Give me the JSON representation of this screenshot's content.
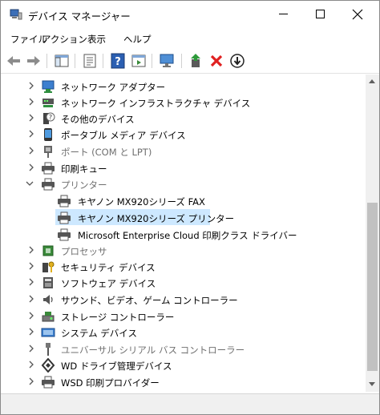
{
  "window": {
    "title": "デバイス マネージャー",
    "icon": "device-manager-icon"
  },
  "menu": [
    "ファイル",
    "アクション",
    "表示",
    "ヘルプ"
  ],
  "toolbar": {
    "buttons": [
      {
        "name": "back-button",
        "icon": "arrow-left-icon"
      },
      {
        "name": "forward-button",
        "icon": "arrow-right-icon"
      },
      {
        "name": "show-hide-console-tree-button",
        "icon": "console-tree-icon"
      },
      {
        "name": "properties-button",
        "icon": "properties-icon"
      },
      {
        "name": "help-button",
        "icon": "help-icon"
      },
      {
        "name": "update-driver-button",
        "icon": "update-driver-icon"
      },
      {
        "name": "scan-hardware-button",
        "icon": "scan-monitor-icon"
      },
      {
        "name": "enable-device-button",
        "icon": "enable-device-icon"
      },
      {
        "name": "uninstall-device-button",
        "icon": "red-x-icon"
      },
      {
        "name": "disable-device-button",
        "icon": "down-arrow-circle-icon"
      }
    ]
  },
  "tree": [
    {
      "label": "ネットワーク アダプター",
      "state": "collapsed",
      "icon": "network-adapter-icon"
    },
    {
      "label": "ネットワーク インフラストラクチャ デバイス",
      "state": "collapsed",
      "icon": "network-infrastructure-icon"
    },
    {
      "label": "その他のデバイス",
      "state": "collapsed",
      "icon": "unknown-device-icon"
    },
    {
      "label": "ポータブル メディア デバイス",
      "state": "collapsed",
      "icon": "portable-device-icon"
    },
    {
      "label": "ポート (COM と LPT)",
      "state": "collapsed",
      "icon": "port-icon",
      "disabled": true
    },
    {
      "label": "印刷キュー",
      "state": "collapsed",
      "icon": "printer-icon"
    },
    {
      "label": "プリンター",
      "state": "expanded",
      "icon": "printer-icon",
      "disabled": true
    },
    {
      "label": "キヤノン MX920シリーズ FAX",
      "state": "child",
      "icon": "printer-icon"
    },
    {
      "label": "キヤノン MX920シリーズ プリンター",
      "state": "child",
      "icon": "printer-icon",
      "selected": true
    },
    {
      "label": "Microsoft Enterprise Cloud 印刷クラス ドライバー",
      "state": "child",
      "icon": "printer-icon"
    },
    {
      "label": "プロセッサ",
      "state": "collapsed",
      "icon": "processor-icon",
      "disabled": true
    },
    {
      "label": "セキュリティ デバイス",
      "state": "collapsed",
      "icon": "security-key-icon"
    },
    {
      "label": "ソフトウェア デバイス",
      "state": "collapsed",
      "icon": "software-device-icon"
    },
    {
      "label": "サウンド、ビデオ、ゲーム コントローラー",
      "state": "collapsed",
      "icon": "speaker-icon"
    },
    {
      "label": "ストレージ コントローラー",
      "state": "collapsed",
      "icon": "storage-controller-icon"
    },
    {
      "label": "システム デバイス",
      "state": "collapsed",
      "icon": "system-device-icon"
    },
    {
      "label": "ユニバーサル シリアル バス コントローラー",
      "state": "collapsed",
      "icon": "usb-icon",
      "disabled": true
    },
    {
      "label": "WD ドライブ管理デバイス",
      "state": "collapsed",
      "icon": "wd-drive-icon"
    },
    {
      "label": "WSD 印刷プロバイダー",
      "state": "collapsed",
      "icon": "printer-icon"
    }
  ]
}
